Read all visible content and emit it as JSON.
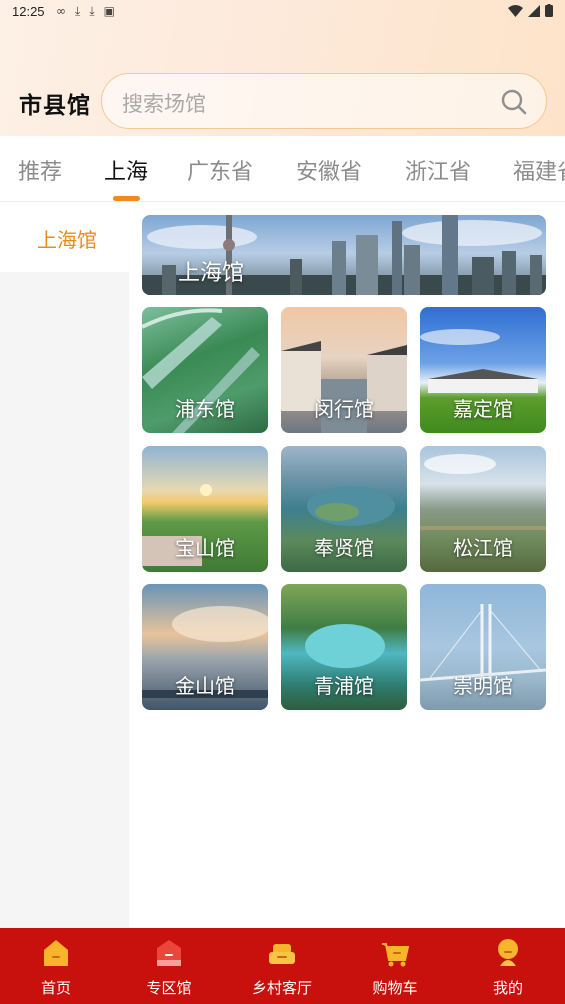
{
  "status_bar": {
    "time": "12:25"
  },
  "header": {
    "title": "市县馆"
  },
  "search": {
    "placeholder": "搜索场馆"
  },
  "tabs": [
    {
      "label": "推荐"
    },
    {
      "label": "上海"
    },
    {
      "label": "广东省"
    },
    {
      "label": "安徽省"
    },
    {
      "label": "浙江省"
    },
    {
      "label": "福建省"
    }
  ],
  "active_tab": "上海",
  "sidebar": {
    "items": [
      {
        "label": "上海馆"
      }
    ]
  },
  "banner": {
    "label": "上海馆"
  },
  "districts": [
    {
      "label": "浦东馆"
    },
    {
      "label": "闵行馆"
    },
    {
      "label": "嘉定馆"
    },
    {
      "label": "宝山馆"
    },
    {
      "label": "奉贤馆"
    },
    {
      "label": "松江馆"
    },
    {
      "label": "金山馆"
    },
    {
      "label": "青浦馆"
    },
    {
      "label": "崇明馆"
    }
  ],
  "bottom_nav": [
    {
      "label": "首页",
      "icon": "home-icon"
    },
    {
      "label": "专区馆",
      "icon": "pavilion-icon"
    },
    {
      "label": "乡村客厅",
      "icon": "sofa-icon"
    },
    {
      "label": "购物车",
      "icon": "cart-icon"
    },
    {
      "label": "我的",
      "icon": "user-icon"
    }
  ],
  "colors": {
    "accent": "#f08a1e",
    "nav_bg": "#c8100c",
    "icon_gold": "#f6b52a"
  }
}
